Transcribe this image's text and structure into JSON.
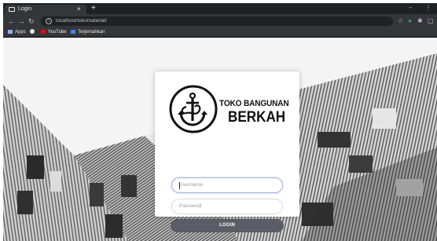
{
  "browser": {
    "tab_title": "Login",
    "tab_close": "×",
    "new_tab": "+",
    "window_controls": {
      "minimize": "–",
      "menu": "⋮"
    },
    "nav_icons": [
      "arrow-left-icon",
      "arrow-right-icon",
      "reload-icon"
    ],
    "url": "localhost/tokomaterial/",
    "toolbar_icons": [
      "star-icon",
      "extension-icon",
      "puzzle-icon",
      "profile-icon"
    ],
    "bookmarks": [
      {
        "label": "Apps",
        "icon": "apps-grid-icon",
        "color": "#8ab4f8"
      },
      {
        "label": "",
        "icon": "globe-icon",
        "color": "#e8eaed"
      },
      {
        "label": "YouTube",
        "icon": "youtube-icon",
        "color": "#ff0000"
      },
      {
        "label": "Terjemahkan",
        "icon": "translate-icon",
        "color": "#4285f4"
      }
    ]
  },
  "login": {
    "brand_line1": "TOKO BANGUNAN",
    "brand_line2": "BERKAH",
    "username_placeholder": "Username",
    "password_placeholder": "Password",
    "login_button": "LOGIN",
    "button_color": "#5b5c66"
  }
}
